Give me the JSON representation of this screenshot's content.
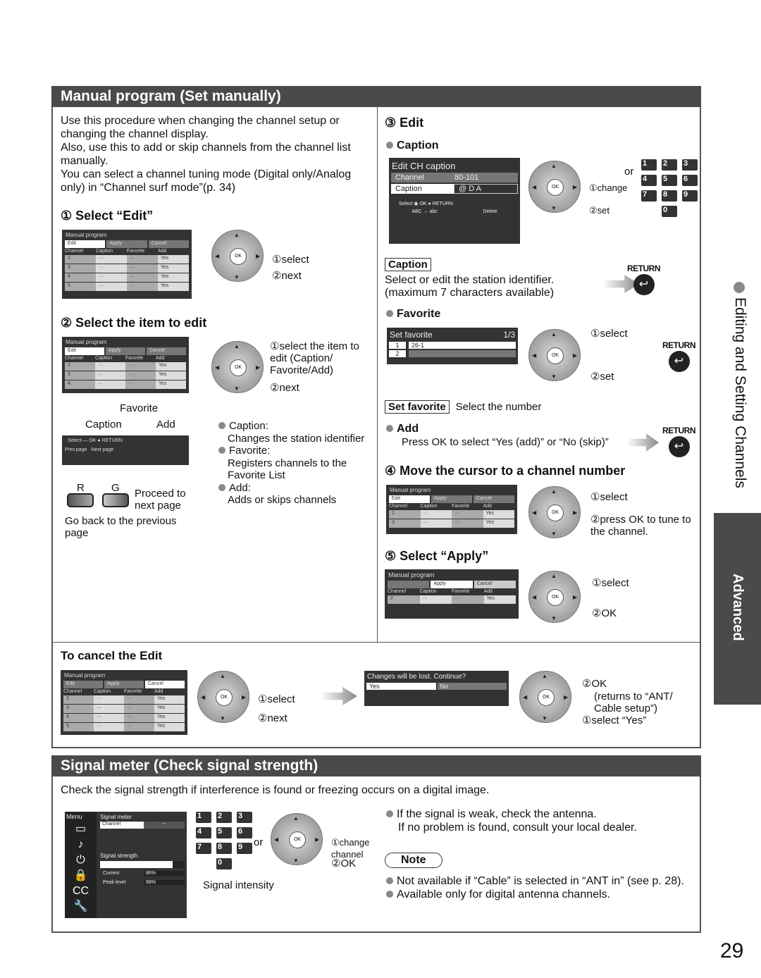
{
  "page_number": "29",
  "side_tab": {
    "chapter": "Editing and Setting Channels",
    "section": "Advanced"
  },
  "manual": {
    "title": "Manual program (Set manually)",
    "intro": [
      "Use this procedure when changing the channel setup or changing the channel display.",
      "Also, use this to add or skip channels from the channel list manually.",
      "You can select a channel tuning mode (Digital only/Analog only) in “Channel surf mode”(p. 34)"
    ],
    "step1": {
      "num": "①",
      "title": "Select “Edit”",
      "labels": [
        "①select",
        "②next"
      ]
    },
    "step2": {
      "num": "②",
      "title": "Select the item to edit",
      "labels": [
        "①select the item to edit (Caption/ Favorite/Add)",
        "②next"
      ],
      "callouts": {
        "favorite": "Favorite",
        "caption": "Caption",
        "add": "Add"
      },
      "osd_footer": {
        "select": "Select",
        "ok": "OK",
        "return": "RETURN",
        "prev": "Prev.page",
        "next": "Next page"
      },
      "r_label": "R",
      "g_label": "G",
      "proceed": "Proceed to next page",
      "goback": "Go back to the previous page",
      "bullets": [
        {
          "h": "Caption:",
          "d": "Changes the station identifier"
        },
        {
          "h": "Favorite:",
          "d": "Registers channels to the Favorite List"
        },
        {
          "h": "Add:",
          "d": "Adds or skips channels"
        }
      ]
    },
    "step3": {
      "num": "③",
      "title": "Edit",
      "caption": {
        "heading": "Caption",
        "osd_title": "Edit CH caption",
        "channel_label": "Channel",
        "channel_value": "80-101",
        "caption_label": "Caption",
        "caption_value": "@ D A",
        "select": "Select",
        "ok": "OK",
        "return": "RETURN",
        "g_hint": "ABC → abc",
        "y_hint": "Delete",
        "or": "or",
        "labels": [
          "①change",
          "②set"
        ],
        "box": "Caption",
        "desc": "Select or edit the station identifier.",
        "desc2": "(maximum 7 characters available)"
      },
      "favorite": {
        "heading": "Favorite",
        "osd_title": "Set favorite",
        "page": "1/3",
        "rows": [
          {
            "n": "1",
            "v": "26-1"
          },
          {
            "n": "2",
            "v": ""
          }
        ],
        "labels": [
          "①select",
          "②set"
        ],
        "box": "Set favorite",
        "desc": "Select the number"
      },
      "add": {
        "heading": "Add",
        "desc": "Press OK to select “Yes (add)” or “No (skip)”"
      }
    },
    "step4": {
      "num": "④",
      "title": "Move the cursor to a channel number",
      "labels": [
        "①select",
        "②press OK to tune to the channel."
      ]
    },
    "step5": {
      "num": "⑤",
      "title": "Select “Apply”",
      "labels": [
        "①select",
        "②OK"
      ]
    },
    "cancel": {
      "title": "To cancel the Edit",
      "labels": [
        "①select",
        "②next"
      ],
      "dialog": "Changes will be lost. Continue?",
      "yes": "Yes",
      "no": "No",
      "labels2": [
        "②OK",
        "(returns to “ANT/ Cable setup”)",
        "①select “Yes”"
      ]
    }
  },
  "osd_table": {
    "title": "Manual program",
    "tabs": [
      "Edit",
      "Apply",
      "Cancel"
    ],
    "columns": [
      "Channel",
      "Caption",
      "Favorite",
      "Add"
    ],
    "rows": [
      [
        "2",
        "···",
        "···",
        "Yes"
      ],
      [
        "3",
        "···",
        "···",
        "Yes"
      ],
      [
        "4",
        "···",
        "···",
        "Yes"
      ],
      [
        "5",
        "···",
        "···",
        "Yes"
      ]
    ]
  },
  "return_label": "RETURN",
  "keypad": [
    "1",
    "2",
    "3",
    "4",
    "5",
    "6",
    "7",
    "8",
    "9",
    "0"
  ],
  "ok_label": "OK",
  "signal": {
    "title": "Signal meter (Check signal strength)",
    "intro": "Check the signal strength if interference is found or freezing occurs on a digital image.",
    "osd": {
      "menu": "Menu",
      "title": "Signal meter",
      "channel": "Channel",
      "channel_value": "--",
      "strength": "Signal strength",
      "current_label": "Current",
      "current": "86%",
      "peak_label": "Peak level",
      "peak": "98%",
      "strength_fraction": 0.86
    },
    "or": "or",
    "labels": [
      "①change channel",
      "②OK"
    ],
    "intensity": "Signal intensity",
    "tips": [
      "If the signal is weak, check the antenna.",
      "If no problem is found, consult your local dealer."
    ],
    "note": "Note",
    "notes": [
      "Not available if “Cable” is selected in “ANT in” (see p. 28).",
      "Available only for digital antenna channels."
    ]
  }
}
